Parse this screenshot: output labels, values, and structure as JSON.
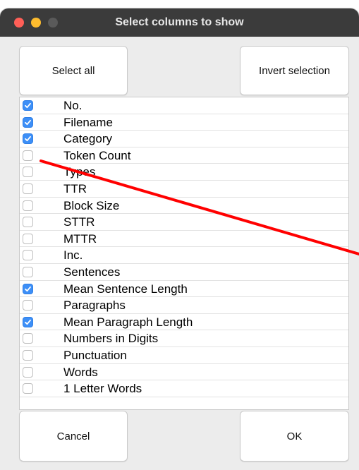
{
  "window": {
    "title": "Select columns to show"
  },
  "buttons": {
    "select_all": "Select all",
    "invert_selection": "Invert selection",
    "cancel": "Cancel",
    "ok": "OK"
  },
  "columns": [
    {
      "label": "No.",
      "checked": true
    },
    {
      "label": "Filename",
      "checked": true
    },
    {
      "label": "Category",
      "checked": true
    },
    {
      "label": "Token Count",
      "checked": false
    },
    {
      "label": "Types",
      "checked": false
    },
    {
      "label": "TTR",
      "checked": false
    },
    {
      "label": "Block Size",
      "checked": false
    },
    {
      "label": "STTR",
      "checked": false
    },
    {
      "label": "MTTR",
      "checked": false
    },
    {
      "label": "Inc.",
      "checked": false
    },
    {
      "label": "Sentences",
      "checked": false
    },
    {
      "label": "Mean Sentence Length",
      "checked": true
    },
    {
      "label": "Paragraphs",
      "checked": false
    },
    {
      "label": "Mean Paragraph Length",
      "checked": true
    },
    {
      "label": "Numbers in Digits",
      "checked": false
    },
    {
      "label": "Punctuation",
      "checked": false
    },
    {
      "label": "Words",
      "checked": false
    },
    {
      "label": "1 Letter Words",
      "checked": false
    }
  ],
  "colors": {
    "checkbox_checked": "#3d8ff7",
    "annotation_line": "#ff0000",
    "titlebar": "#3b3b3b"
  }
}
